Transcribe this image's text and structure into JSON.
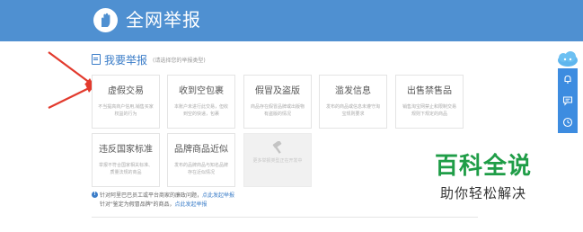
{
  "header": {
    "title": "全网举报",
    "logo_icon": "hand-icon"
  },
  "section": {
    "title": "我要举报",
    "hint": "(请选择您的举报类型)"
  },
  "cards": [
    {
      "title": "虚假交易",
      "desc": "不当提高商户信用,销售买家权益的行为"
    },
    {
      "title": "收到空包裹",
      "desc": "本账户未进行此交易，但收到空的快递，包裹"
    },
    {
      "title": "假冒及盗版",
      "desc": "商品存在假冒品牌或出版物有盗版的情况"
    },
    {
      "title": "滥发信息",
      "desc": "发布的商品或信息未遵守淘宝规则要求"
    },
    {
      "title": "出售禁售品",
      "desc": "销售淘宝网禁止和限制交易规则下规定的商品"
    },
    {
      "title": "违反国家标准",
      "desc": "举报不符合国家相关标准、质量法规的商品"
    },
    {
      "title": "品牌商品近似",
      "desc": "发布的品牌商品与知名品牌存在近似情况"
    }
  ],
  "disabled_card": {
    "icon": "hammer-icon",
    "desc": "更多举报类型正在开发中"
  },
  "notes": {
    "line1_text": "针对阿里巴巴员工或平台商家的廉政问题，",
    "line1_link": "点此发起举报",
    "line2_text": "针对\"鉴定为假冒品牌\"的商品，",
    "line2_link": "点此发起举报"
  },
  "side_toolbar": [
    "bell-icon",
    "chat-icon",
    "clock-icon"
  ],
  "watermark": {
    "main": "百科全说",
    "sub": "助你轻松解决"
  },
  "colors": {
    "header": "#4f90d1",
    "accent": "#3b7dc8",
    "watermark_green": "#1f9d47",
    "arrow_red": "#e23a2d"
  }
}
